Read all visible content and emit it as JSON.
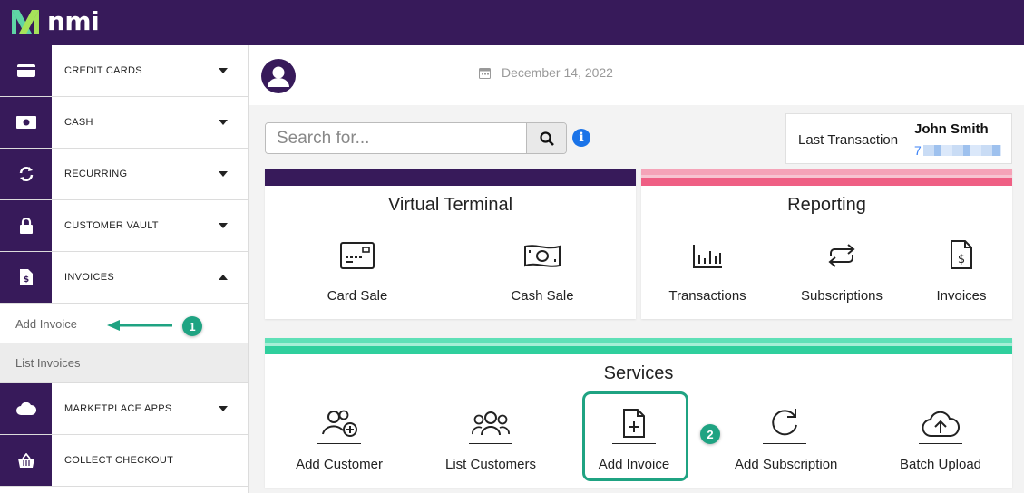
{
  "brand": {
    "name": "nmi"
  },
  "sidebar": {
    "items": [
      {
        "label": "CREDIT CARDS",
        "icon": "credit-card-icon"
      },
      {
        "label": "CASH",
        "icon": "cash-icon"
      },
      {
        "label": "RECURRING",
        "icon": "recurring-icon"
      },
      {
        "label": "CUSTOMER VAULT",
        "icon": "lock-icon"
      },
      {
        "label": "INVOICES",
        "icon": "invoice-icon",
        "expanded": true
      }
    ],
    "sub_items": [
      {
        "label": "Add Invoice"
      },
      {
        "label": "List Invoices"
      }
    ],
    "items_after": [
      {
        "label": "MARKETPLACE APPS",
        "icon": "cloud-icon"
      },
      {
        "label": "COLLECT CHECKOUT",
        "icon": "basket-icon"
      }
    ]
  },
  "header": {
    "date": "December 14, 2022"
  },
  "search": {
    "placeholder": "Search for..."
  },
  "last_transaction": {
    "label": "Last Transaction",
    "name": "John Smith",
    "id_prefix": "7"
  },
  "virtual_terminal": {
    "title": "Virtual Terminal",
    "tiles": [
      {
        "label": "Card Sale"
      },
      {
        "label": "Cash Sale"
      }
    ]
  },
  "reporting": {
    "title": "Reporting",
    "tiles": [
      {
        "label": "Transactions"
      },
      {
        "label": "Subscriptions"
      },
      {
        "label": "Invoices"
      }
    ]
  },
  "services": {
    "title": "Services",
    "tiles": [
      {
        "label": "Add Customer"
      },
      {
        "label": "List Customers"
      },
      {
        "label": "Add Invoice"
      },
      {
        "label": "Add Subscription"
      },
      {
        "label": "Batch Upload"
      }
    ]
  },
  "annotations": {
    "step1": "1",
    "step2": "2"
  },
  "colors": {
    "brand_purple": "#371a5a",
    "accent_green": "#1fa382",
    "reporting_pink": "#ef5f84",
    "services_teal": "#2fcf9d",
    "info_blue": "#1a73e8"
  }
}
